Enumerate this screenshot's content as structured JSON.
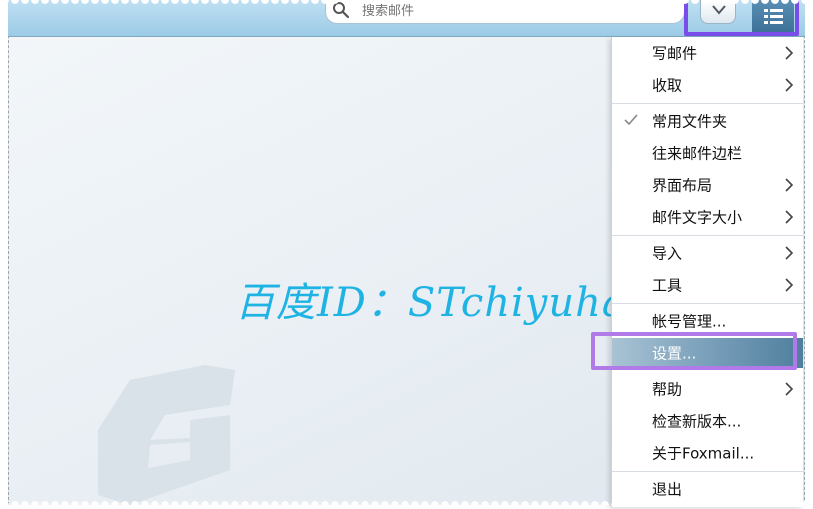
{
  "search": {
    "placeholder": "搜索邮件"
  },
  "watermark": {
    "text": "百度ID：STchiyuhai"
  },
  "menu": {
    "items": [
      {
        "label": "写邮件"
      },
      {
        "label": "收取"
      },
      {
        "label": "常用文件夹"
      },
      {
        "label": "往来邮件边栏"
      },
      {
        "label": "界面布局"
      },
      {
        "label": "邮件文字大小"
      },
      {
        "label": "导入"
      },
      {
        "label": "工具"
      },
      {
        "label": "帐号管理..."
      },
      {
        "label": "设置..."
      },
      {
        "label": "帮助"
      },
      {
        "label": "检查新版本..."
      },
      {
        "label": "关于Foxmail..."
      },
      {
        "label": "退出"
      }
    ]
  },
  "colors": {
    "highlight_box_top": "#7b4de8",
    "highlight_box_menu": "#b07be8",
    "watermark": "#1fb3e4",
    "toolbar": "#9ccbe6"
  },
  "icons": [
    "search-icon",
    "chevron-down-icon",
    "menu-icon",
    "check-icon",
    "chevron-right-icon",
    "foxmail-logo"
  ]
}
